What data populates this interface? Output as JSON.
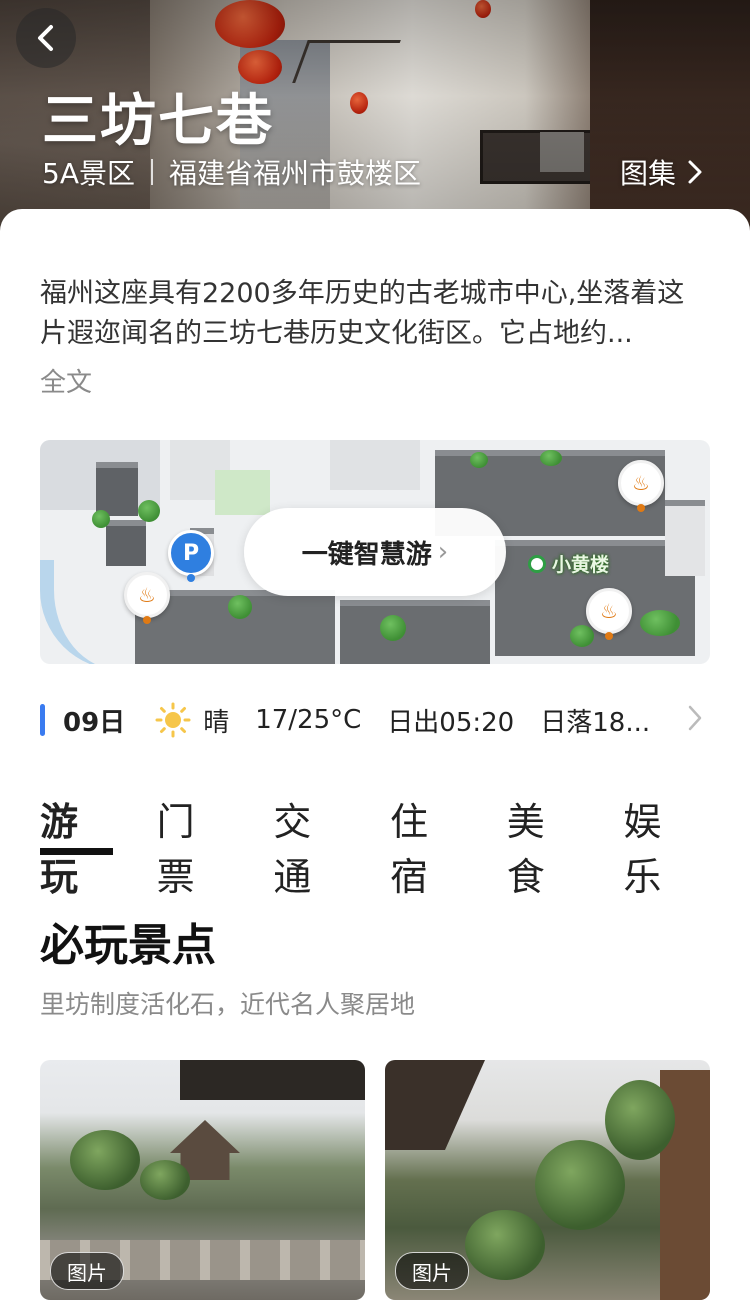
{
  "hero": {
    "title": "三坊七巷",
    "level": "5A景区",
    "location": "福建省福州市鼓楼区",
    "gallery_label": "图集"
  },
  "intro": {
    "text": "福州这座具有2200多年历史的古老城市中心,坐落着这片遐迩闻名的三坊七巷历史文化街区。它占地约...",
    "more_label": "全文"
  },
  "map": {
    "smart_tour_label": "一键智慧游",
    "poi_label": "小黄楼",
    "parking_label": "P"
  },
  "weather": {
    "day": "09日",
    "condition": "晴",
    "temp": "17/25°C",
    "sunrise": "日出05:20",
    "sunset": "日落18..."
  },
  "tabs": [
    {
      "label": "游玩",
      "active": true
    },
    {
      "label": "门票",
      "active": false
    },
    {
      "label": "交通",
      "active": false
    },
    {
      "label": "住宿",
      "active": false
    },
    {
      "label": "美食",
      "active": false
    },
    {
      "label": "娱乐",
      "active": false
    }
  ],
  "section": {
    "title": "必玩景点",
    "subtitle": "里坊制度活化石，近代名人聚居地"
  },
  "cards": [
    {
      "tag": "图片"
    },
    {
      "tag": "图片"
    }
  ],
  "colors": {
    "accent_blue": "#3a7bf0",
    "tab_underline": "#111111",
    "muted_text": "#8a8a8a"
  }
}
